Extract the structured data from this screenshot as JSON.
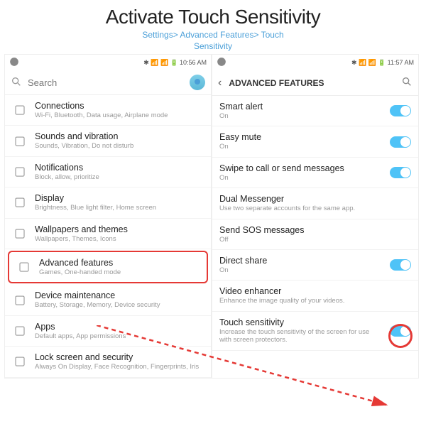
{
  "header": {
    "title": "Activate Touch Sensitivity",
    "path1": "Settings> Advanced Features> Touch",
    "path2": "Sensitivity"
  },
  "status": {
    "time1": "10:56 AM",
    "time2": "11:57 AM"
  },
  "search": {
    "placeholder": "Search"
  },
  "screen2": {
    "title": "ADVANCED FEATURES"
  },
  "s1": [
    {
      "t": "Connections",
      "s": "Wi-Fi, Bluetooth, Data usage, Airplane mode"
    },
    {
      "t": "Sounds and vibration",
      "s": "Sounds, Vibration, Do not disturb"
    },
    {
      "t": "Notifications",
      "s": "Block, allow, prioritize"
    },
    {
      "t": "Display",
      "s": "Brightness, Blue light filter, Home screen"
    },
    {
      "t": "Wallpapers and themes",
      "s": "Wallpapers, Themes, Icons"
    },
    {
      "t": "Advanced features",
      "s": "Games, One-handed mode"
    },
    {
      "t": "Device maintenance",
      "s": "Battery, Storage, Memory, Device security"
    },
    {
      "t": "Apps",
      "s": "Default apps, App permissions"
    },
    {
      "t": "Lock screen and security",
      "s": "Always On Display, Face Recognition, Fingerprints, Iris"
    }
  ],
  "s2": [
    {
      "t": "Smart alert",
      "s": "On",
      "on": true
    },
    {
      "t": "Easy mute",
      "s": "On",
      "on": true
    },
    {
      "t": "Swipe to call or send messages",
      "s": "On",
      "on": true
    },
    {
      "t": "Dual Messenger",
      "s": "Use two separate accounts for the same app."
    },
    {
      "t": "Send SOS messages",
      "s": "Off"
    },
    {
      "t": "Direct share",
      "s": "On",
      "on": true
    },
    {
      "t": "Video enhancer",
      "s": "Enhance the image quality of your videos."
    },
    {
      "t": "Touch sensitivity",
      "s": "Increase the touch sensitivity of the screen for use with screen protectors.",
      "on": true
    }
  ]
}
